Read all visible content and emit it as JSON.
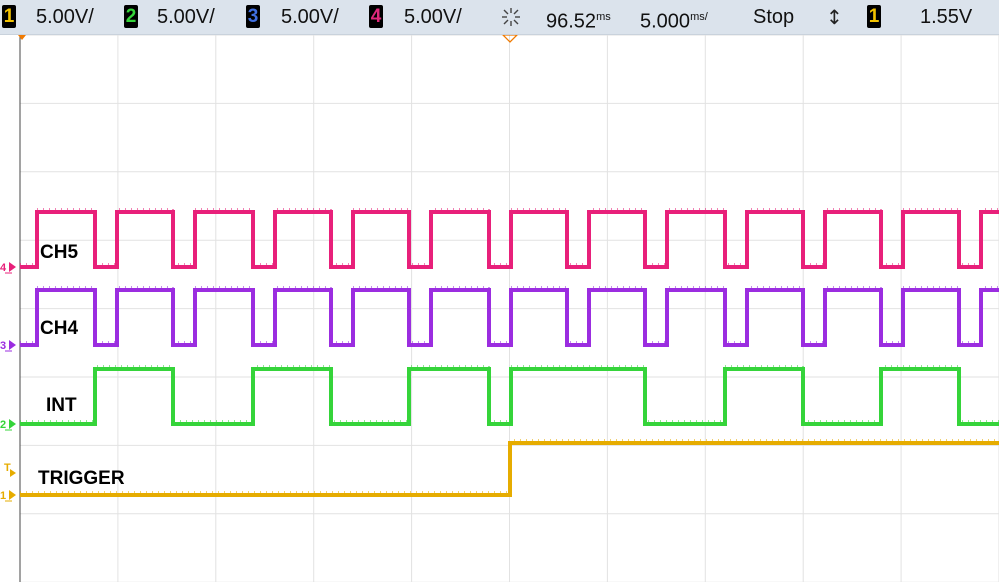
{
  "topbar": {
    "ch1": {
      "num": "1",
      "scale": "5.00V/",
      "color": "#f2c200"
    },
    "ch2": {
      "num": "2",
      "scale": "5.00V/",
      "color": "#35d43a"
    },
    "ch3": {
      "num": "3",
      "scale": "5.00V/",
      "color": "#3f6fe0"
    },
    "ch4": {
      "num": "4",
      "scale": "5.00V/",
      "color": "#e0287a"
    },
    "acq_icon": "acquire-icon",
    "delay": "96.52",
    "delay_unit": "ms",
    "timebase": "5.000",
    "timebase_unit": "ms/",
    "run_state": "Stop",
    "trigger_icon": "trigger-edge-icon",
    "trig_ch": {
      "num": "1",
      "color": "#f2c200"
    },
    "trig_level": "1.55V"
  },
  "traces": [
    {
      "label": "CH5",
      "color": "#e8207a",
      "marker": "4"
    },
    {
      "label": "CH4",
      "color": "#9b2de0",
      "marker": "3"
    },
    {
      "label": "INT",
      "color": "#35d43a",
      "marker": "2"
    },
    {
      "label": "TRIGGER",
      "color": "#e6ac00",
      "marker": "1"
    }
  ]
}
